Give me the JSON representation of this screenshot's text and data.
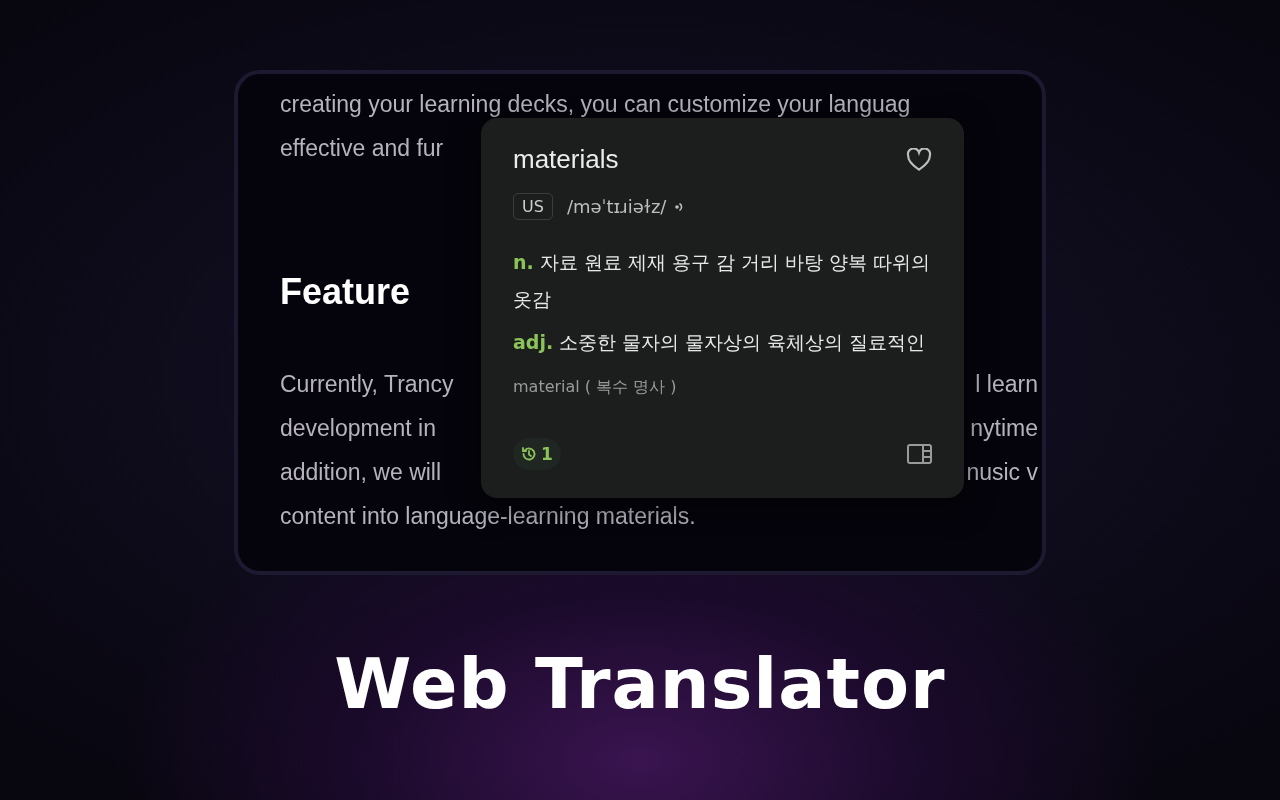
{
  "article": {
    "intro": [
      {
        "left": "creating your learning decks, you can customize your languag"
      },
      {
        "left": "effective and fur"
      }
    ],
    "heading": "Feature",
    "paragraph": [
      {
        "left": "Currently, Trancy",
        "right": "l learn"
      },
      {
        "left": "development in",
        "right": "nytime"
      },
      {
        "left": "addition, we will",
        "right": "nusic v"
      },
      {
        "left": "content into language-learning materials."
      }
    ]
  },
  "popup": {
    "word": "materials",
    "favorite": false,
    "region": "US",
    "phonetic": "/məˈtɪɹiəɫz/",
    "definitions": [
      {
        "pos": "n.",
        "meaning": "자료 원료 제재 용구 감 거리 바탕 양복 따위의 옷감"
      },
      {
        "pos": "adj.",
        "meaning": "소중한 물자의 물자상의 육체상의 질료적인"
      }
    ],
    "form": "material (  복수 명사  )",
    "history_count": "1"
  },
  "caption": "Web Translator"
}
